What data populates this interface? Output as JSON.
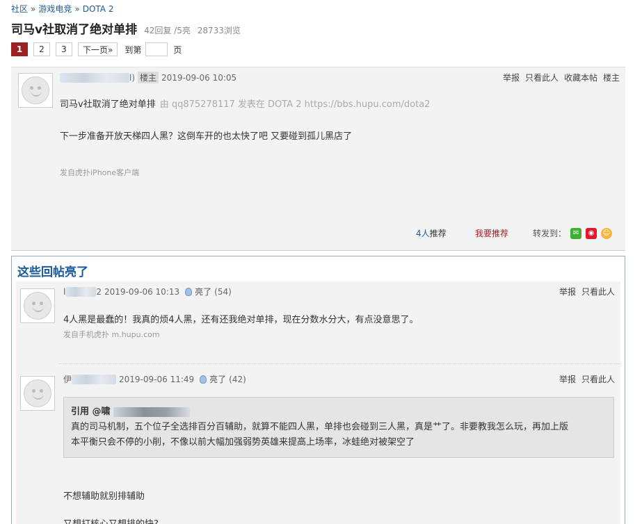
{
  "breadcrumb": {
    "items": [
      "社区",
      "游戏电竞",
      "DOTA 2"
    ],
    "separator": "»"
  },
  "thread": {
    "title": "司马v社取消了绝对单排",
    "replies": "42回复 /5亮",
    "views": "28733浏览"
  },
  "pager": {
    "pages": [
      "1",
      "2",
      "3"
    ],
    "next_label": "下一页»",
    "jump_label": "到第",
    "jump_suffix": "页"
  },
  "main_post": {
    "username_tail": "l)",
    "op_badge": "楼主",
    "time": "2019-09-06 10:05",
    "actions": [
      "举报",
      "只看此人",
      "收藏本帖",
      "楼主"
    ],
    "title_line": "司马v社取消了绝对单排",
    "source": "由  qq875278117 发表在 DOTA 2 https://bbs.hupu.com/dota2",
    "body": "下一步准备开放天梯四人黑？这倒车开的也太快了吧 又要碰到孤儿黑店了",
    "via": "发自虎扑iPhone客户端",
    "recommend_count": "4人",
    "recommend_suffix": "推荐",
    "recommend_me": "我要推荐",
    "share_label": "转发到："
  },
  "hot_section": {
    "title": "这些回帖亮了",
    "replies": [
      {
        "username_head": "l",
        "username_tail": "2",
        "time": "2019-09-06 10:13",
        "light_label": "亮了",
        "light_count": "(54)",
        "actions": [
          "举报",
          "只看此人"
        ],
        "content": "4人黑是最蠢的！我真的烦4人黑，还有还我绝对单排，现在分数水分大，有点没意思了。",
        "via": "发自手机虎扑 m.hupu.com"
      },
      {
        "username_head": "伊",
        "time": "2019-09-06 11:49",
        "light_label": "亮了",
        "light_count": "(42)",
        "actions": [
          "举报",
          "只看此人"
        ],
        "quote_label": "引用 @",
        "quote_user_head": "啸",
        "quote_text_1": "真的司马机制，五个位子全选排百分百辅助，就算不能四人黑，单排也会碰到三人黑，真是艹了。非要教我怎么玩，再加上版",
        "quote_text_2": "本平衡只会不停的小削，不像以前大幅加强弱势英雄来提高上场率，冰蛙绝对被架空了",
        "content_1": "不想辅助就别排辅助",
        "content_2": "又想打核心又想排的快?"
      }
    ]
  }
}
